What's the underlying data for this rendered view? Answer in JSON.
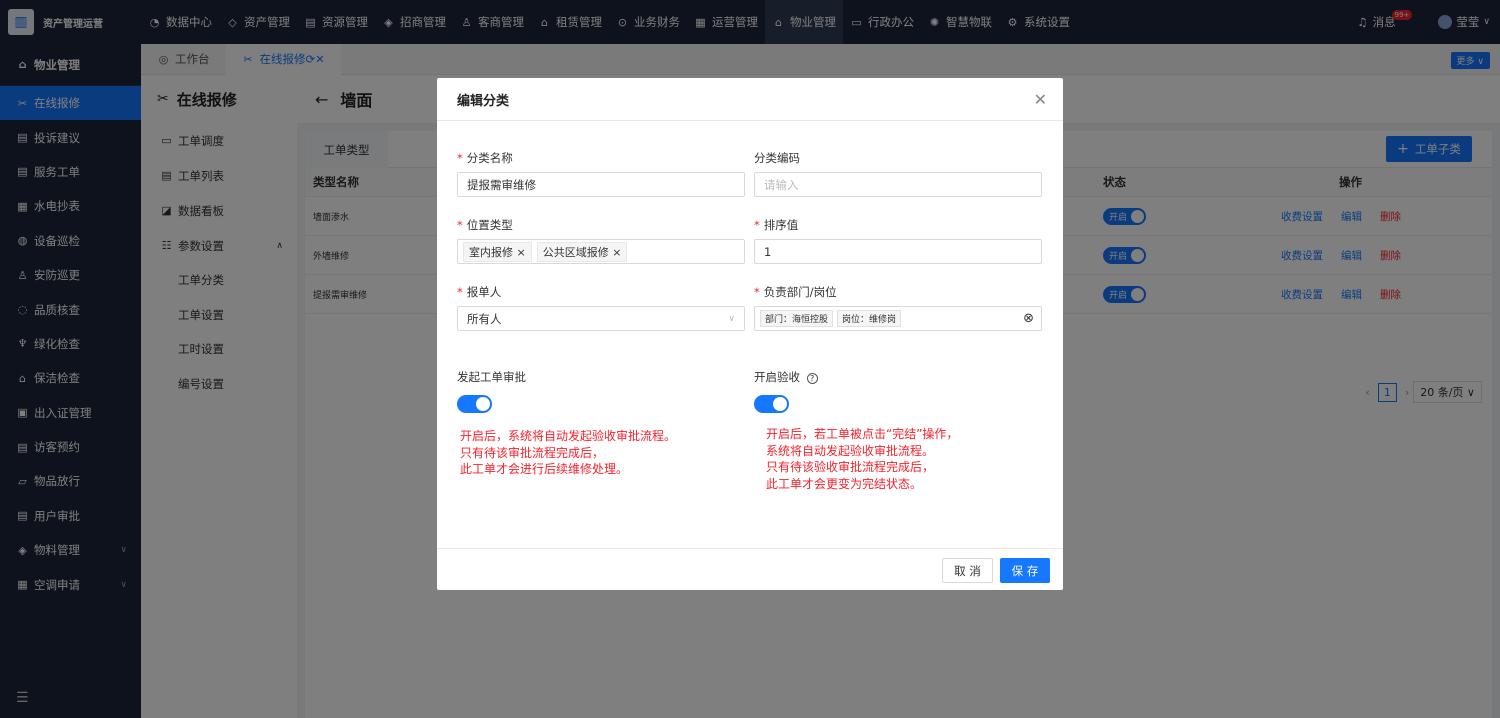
{
  "app": {
    "name": "资产管理运营"
  },
  "topnav": [
    {
      "icon": "dashboard-icon",
      "glyph": "◔",
      "label": "数据中心"
    },
    {
      "icon": "cube-icon",
      "glyph": "◇",
      "label": "资产管理"
    },
    {
      "icon": "building-icon",
      "glyph": "▤",
      "label": "资源管理"
    },
    {
      "icon": "tag-icon",
      "glyph": "◈",
      "label": "招商管理"
    },
    {
      "icon": "users-icon",
      "glyph": "♙",
      "label": "客商管理"
    },
    {
      "icon": "house-icon",
      "glyph": "⌂",
      "label": "租赁管理"
    },
    {
      "icon": "coin-icon",
      "glyph": "⊙",
      "label": "业务财务"
    },
    {
      "icon": "chart-icon",
      "glyph": "▦",
      "label": "运营管理"
    },
    {
      "icon": "home-icon",
      "glyph": "⌂",
      "label": "物业管理",
      "active": true
    },
    {
      "icon": "monitor-icon",
      "glyph": "▭",
      "label": "行政办公"
    },
    {
      "icon": "iot-icon",
      "glyph": "✺",
      "label": "智慧物联"
    },
    {
      "icon": "settings-icon",
      "glyph": "⚙",
      "label": "系统设置"
    }
  ],
  "topright": {
    "messages": "消息",
    "badge": "99+",
    "user": "莹莹"
  },
  "sidebar": {
    "title": "物业管理",
    "items": [
      {
        "label": "在线报修",
        "glyph": "✂",
        "active": true
      },
      {
        "label": "投诉建议",
        "glyph": "▤"
      },
      {
        "label": "服务工单",
        "glyph": "▤"
      },
      {
        "label": "水电抄表",
        "glyph": "▦"
      },
      {
        "label": "设备巡检",
        "glyph": "◍"
      },
      {
        "label": "安防巡更",
        "glyph": "♙"
      },
      {
        "label": "品质核查",
        "glyph": "◌"
      },
      {
        "label": "绿化检查",
        "glyph": "♆"
      },
      {
        "label": "保洁检查",
        "glyph": "⌂"
      },
      {
        "label": "出入证管理",
        "glyph": "▣"
      },
      {
        "label": "访客预约",
        "glyph": "▤"
      },
      {
        "label": "物品放行",
        "glyph": "▱"
      },
      {
        "label": "用户审批",
        "glyph": "▤"
      },
      {
        "label": "物料管理",
        "glyph": "◈",
        "chev": true
      },
      {
        "label": "空调申请",
        "glyph": "▦",
        "chev": true
      }
    ]
  },
  "tabs": [
    {
      "label": "工作台",
      "glyph": "◎"
    },
    {
      "label": "在线报修",
      "glyph": "✂",
      "active": true
    }
  ],
  "more": "更多",
  "subside": {
    "title": "在线报修",
    "items": [
      {
        "label": "工单调度",
        "glyph": "▭"
      },
      {
        "label": "工单列表",
        "glyph": "▤"
      },
      {
        "label": "数据看板",
        "glyph": "◪"
      },
      {
        "label": "参数设置",
        "glyph": "☷",
        "chev": true
      }
    ],
    "subitems": [
      "工单分类",
      "工单设置",
      "工时设置",
      "编号设置"
    ]
  },
  "page": {
    "title": "墙面",
    "tab": "工单类型",
    "add": "工单子类"
  },
  "table": {
    "headers": {
      "name": "类型名称",
      "status": "状态",
      "ops": "操作"
    },
    "rows": [
      {
        "name": "墙面渗水",
        "status": "开启"
      },
      {
        "name": "外墙维修",
        "status": "开启"
      },
      {
        "name": "提报需审维修",
        "status": "开启"
      }
    ],
    "actions": {
      "fee": "收费设置",
      "edit": "编辑",
      "del": "删除"
    }
  },
  "pager": {
    "page": "1",
    "size": "20 条/页"
  },
  "modal": {
    "title": "编辑分类",
    "name_label": "分类名称",
    "name_value": "提报需审维修",
    "code_label": "分类编码",
    "code_placeholder": "请输入",
    "loc_label": "位置类型",
    "loc_tags": [
      "室内报修",
      "公共区域报修"
    ],
    "sort_label": "排序值",
    "sort_value": "1",
    "reporter_label": "报单人",
    "reporter_value": "所有人",
    "dept_label": "负责部门/岗位",
    "dept_tags": [
      "部门：海恒控股",
      "岗位：维修岗"
    ],
    "approve_label": "发起工单审批",
    "accept_label": "开启验收",
    "approve_hint": [
      "开启后，系统将自动发起验收审批流程。",
      "只有待该审批流程完成后，",
      "此工单才会进行后续维修处理。"
    ],
    "accept_hint": [
      "开启后，若工单被点击“完结”操作，",
      "系统将自动发起验收审批流程。",
      "只有待该验收审批流程完成后，",
      "此工单才会更变为完结状态。"
    ],
    "cancel": "取 消",
    "save": "保 存"
  }
}
